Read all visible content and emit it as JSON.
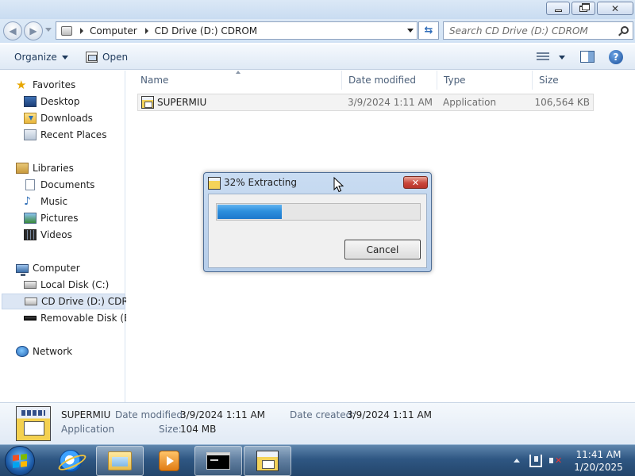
{
  "window": {
    "minimize_icon": "minimize-icon",
    "maximize_icon": "maximize-icon",
    "close_glyph": "✕"
  },
  "address": {
    "crumbs": [
      "Computer",
      "CD Drive (D:) CDROM"
    ],
    "search_placeholder": "Search CD Drive (D:) CDROM"
  },
  "toolbar": {
    "organize_label": "Organize",
    "open_label": "Open",
    "help_glyph": "?"
  },
  "nav": {
    "favorites": {
      "label": "Favorites",
      "items": [
        "Desktop",
        "Downloads",
        "Recent Places"
      ]
    },
    "libraries": {
      "label": "Libraries",
      "items": [
        "Documents",
        "Music",
        "Pictures",
        "Videos"
      ]
    },
    "computer": {
      "label": "Computer",
      "items": [
        "Local Disk (C:)",
        "CD Drive (D:) CDROM",
        "Removable Disk (E:)"
      ]
    },
    "network": {
      "label": "Network"
    }
  },
  "filelist": {
    "columns": [
      "Name",
      "Date modified",
      "Type",
      "Size"
    ],
    "rows": [
      {
        "name": "SUPERMIU",
        "date": "3/9/2024 1:11 AM",
        "type": "Application",
        "size": "106,564 KB"
      }
    ]
  },
  "details": {
    "name": "SUPERMIU",
    "type": "Application",
    "date_modified_label": "Date modified:",
    "date_modified": "3/9/2024 1:11 AM",
    "date_created_label": "Date created:",
    "date_created": "3/9/2024 1:11 AM",
    "size_label": "Size:",
    "size": "104 MB"
  },
  "dialog": {
    "title": "32% Extracting",
    "progress_percent": 32,
    "cancel_label": "Cancel",
    "close_glyph": "✕"
  },
  "taskbar": {
    "time": "11:41 AM",
    "date": "1/20/2025"
  },
  "colors": {
    "progress_fill": "#2d8fdd",
    "close_button": "#c9463a",
    "taskbar": "#2f5783"
  }
}
